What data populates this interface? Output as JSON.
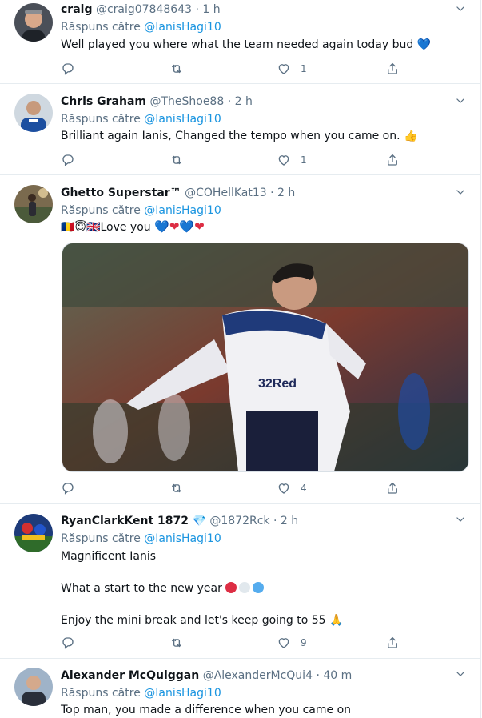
{
  "reply_prefix": "Răspuns către",
  "tweets": [
    {
      "name": "craig",
      "handle": "@craig07848643",
      "sep": "·",
      "time": "1 h",
      "reply_to": "@IanisHagi10",
      "text": "Well played you where what the team needed again today bud",
      "emoji": "💙",
      "likes": "1"
    },
    {
      "name": "Chris Graham",
      "handle": "@TheShoe88",
      "sep": "·",
      "time": "2 h",
      "reply_to": "@IanisHagi10",
      "text": "Brilliant again Ianis, Changed the tempo when you came on.",
      "emoji": "👍",
      "likes": "1"
    },
    {
      "name": "Ghetto Superstar™",
      "handle": "@COHellKat13",
      "sep": "·",
      "time": "2 h",
      "reply_to": "@IanisHagi10",
      "text_prefix": "🇷🇴😇🇬🇧",
      "text": "Love you",
      "hearts": [
        "💙",
        "❤",
        "💙",
        "❤"
      ],
      "likes": "4",
      "photo_text": "32Red"
    },
    {
      "name": "RyanClarkKent 1872",
      "badge": "💎",
      "handle": "@1872Rck",
      "sep": "·",
      "time": "2 h",
      "reply_to": "@IanisHagi10",
      "line1": "Magnificent Ianis",
      "line2": "What a start to the new year",
      "line3": "Enjoy the mini break and let's keep going to 55",
      "line3_emoji": "🙏",
      "likes": "9"
    },
    {
      "name": "Alexander McQuiggan",
      "handle": "@AlexanderMcQui4",
      "sep": "·",
      "time": "40 m",
      "reply_to": "@IanisHagi10",
      "text": "Top man, you made a difference when you came on"
    }
  ],
  "colors": {
    "name": "#0f1419",
    "secondary": "#5b7083",
    "link": "#1b95e0",
    "divider": "#e6ecf0",
    "dot_red": "#dd2e44",
    "dot_white": "#e1e8ed",
    "dot_blue": "#55acee"
  },
  "icons": [
    "reply-icon",
    "retweet-icon",
    "like-icon",
    "share-icon",
    "chevron-down-icon"
  ]
}
